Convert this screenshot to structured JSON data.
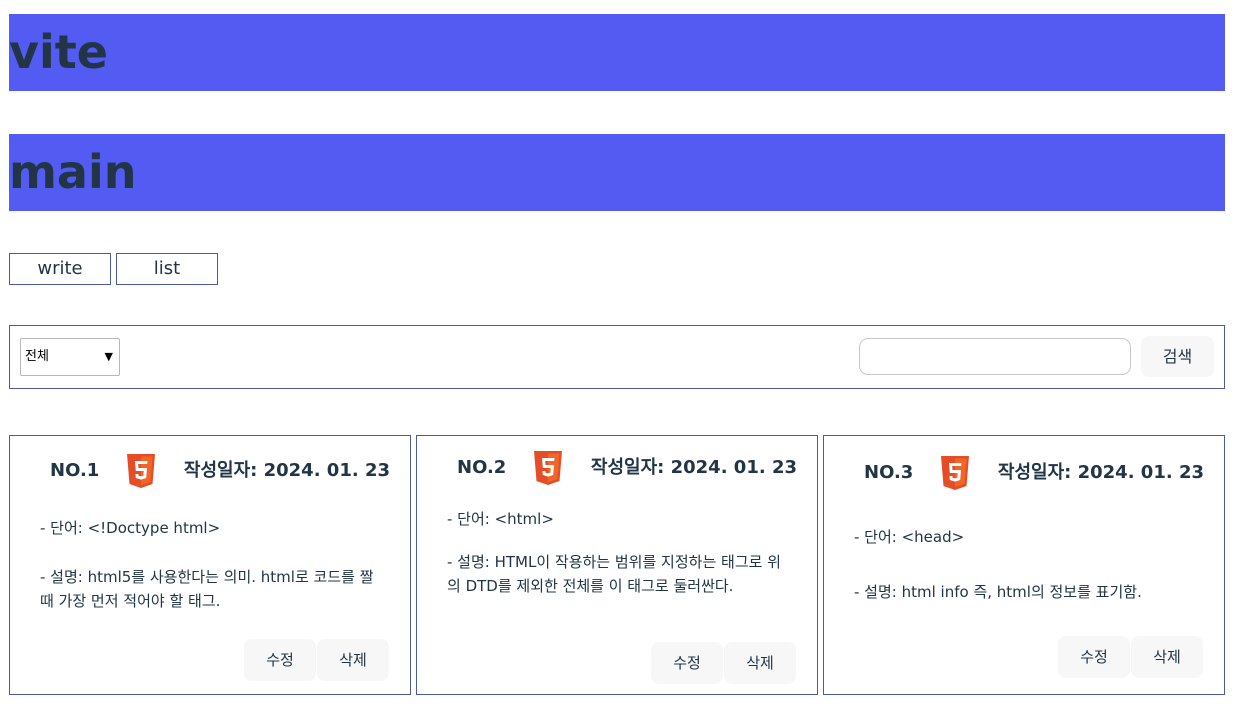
{
  "header": {
    "vite_title": "vite",
    "main_title": "main"
  },
  "nav": {
    "write_label": "write",
    "list_label": "list"
  },
  "filter": {
    "selected": "전체",
    "search_value": "",
    "search_button": "검색"
  },
  "colors": {
    "banner": "#535bf2",
    "border": "#4a5a9a",
    "html5_orange": "#e44d26"
  },
  "cards": [
    {
      "no": "NO.1",
      "icon": "html5-icon",
      "date": "작성일자: 2024. 01. 23",
      "word": "- 단어: <!Doctype html>",
      "desc": "- 설명: html5를 사용한다는 의미. html로 코드를 짤 때 가장 먼저 적어야 할 태그.",
      "edit_label": "수정",
      "delete_label": "삭제"
    },
    {
      "no": "NO.2",
      "icon": "html5-icon",
      "date": "작성일자: 2024. 01. 23",
      "word": "- 단어: <html>",
      "desc": "- 설명: HTML이 작용하는 범위를 지정하는 태그로 위의 DTD를 제외한 전체를 이 태그로 둘러싼다.",
      "edit_label": "수정",
      "delete_label": "삭제"
    },
    {
      "no": "NO.3",
      "icon": "html5-icon",
      "date": "작성일자: 2024. 01. 23",
      "word": "- 단어: <head>",
      "desc": "- 설명: html info 즉, html의 정보를 표기함.",
      "edit_label": "수정",
      "delete_label": "삭제"
    }
  ]
}
